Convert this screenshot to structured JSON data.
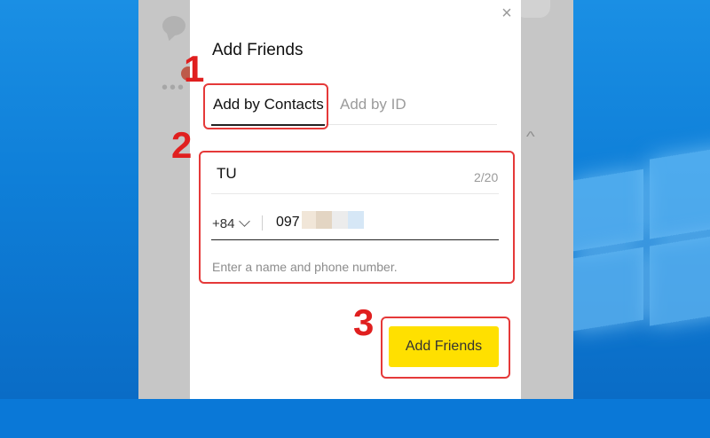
{
  "dialog": {
    "title": "Add Friends",
    "close_icon": "close-icon"
  },
  "tabs": [
    {
      "label": "Add by Contacts",
      "active": true
    },
    {
      "label": "Add by ID",
      "active": false
    }
  ],
  "form": {
    "name_value": "TU",
    "name_counter": "2/20",
    "country_code": "+84",
    "phone_value": "097",
    "hint": "Enter a name and phone number.",
    "submit_label": "Add Friends"
  },
  "annotations": {
    "step1": "1",
    "step2": "2",
    "step3": "3"
  },
  "colors": {
    "accent_button": "#ffe000",
    "annotation_red": "#e01f1f",
    "desktop_blue": "#0f7fd8"
  }
}
